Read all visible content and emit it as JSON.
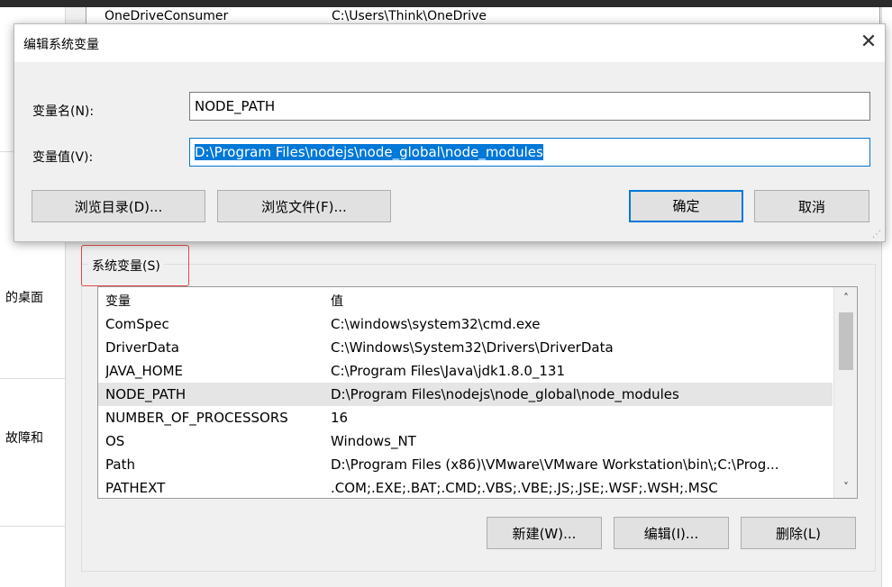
{
  "background": {
    "user_var_peek": {
      "name": "OneDriveConsumer",
      "value": "C:\\Users\\Think\\OneDrive"
    },
    "left_pane_texts": [
      "的桌面",
      "故障和"
    ],
    "system_vars": {
      "group_label": "系统变量(S)",
      "columns": {
        "name": "变量",
        "value": "值"
      },
      "rows": [
        {
          "name": "ComSpec",
          "value": "C:\\windows\\system32\\cmd.exe"
        },
        {
          "name": "DriverData",
          "value": "C:\\Windows\\System32\\Drivers\\DriverData"
        },
        {
          "name": "JAVA_HOME",
          "value": "C:\\Program Files\\Java\\jdk1.8.0_131"
        },
        {
          "name": "NODE_PATH",
          "value": "D:\\Program Files\\nodejs\\node_global\\node_modules"
        },
        {
          "name": "NUMBER_OF_PROCESSORS",
          "value": "16"
        },
        {
          "name": "OS",
          "value": "Windows_NT"
        },
        {
          "name": "Path",
          "value": "D:\\Program Files (x86)\\VMware\\VMware Workstation\\bin\\;C:\\Prog..."
        },
        {
          "name": "PATHEXT",
          "value": ".COM;.EXE;.BAT;.CMD;.VBS;.VBE;.JS;.JSE;.WSF;.WSH;.MSC"
        }
      ],
      "selected_row": 3,
      "buttons": {
        "new": "新建(W)...",
        "edit": "编辑(I)...",
        "delete": "删除(L)"
      }
    }
  },
  "dialog": {
    "title": "编辑系统变量",
    "close_glyph": "✕",
    "name_label": "变量名(N):",
    "name_value": "NODE_PATH",
    "value_label": "变量值(V):",
    "value_value": "D:\\Program Files\\nodejs\\node_global\\node_modules",
    "buttons": {
      "browse_dir": "浏览目录(D)...",
      "browse_file": "浏览文件(F)...",
      "ok": "确定",
      "cancel": "取消"
    }
  },
  "icons": {
    "scroll_up": "˄",
    "scroll_down": "˅",
    "resize_grip": "⋰"
  }
}
